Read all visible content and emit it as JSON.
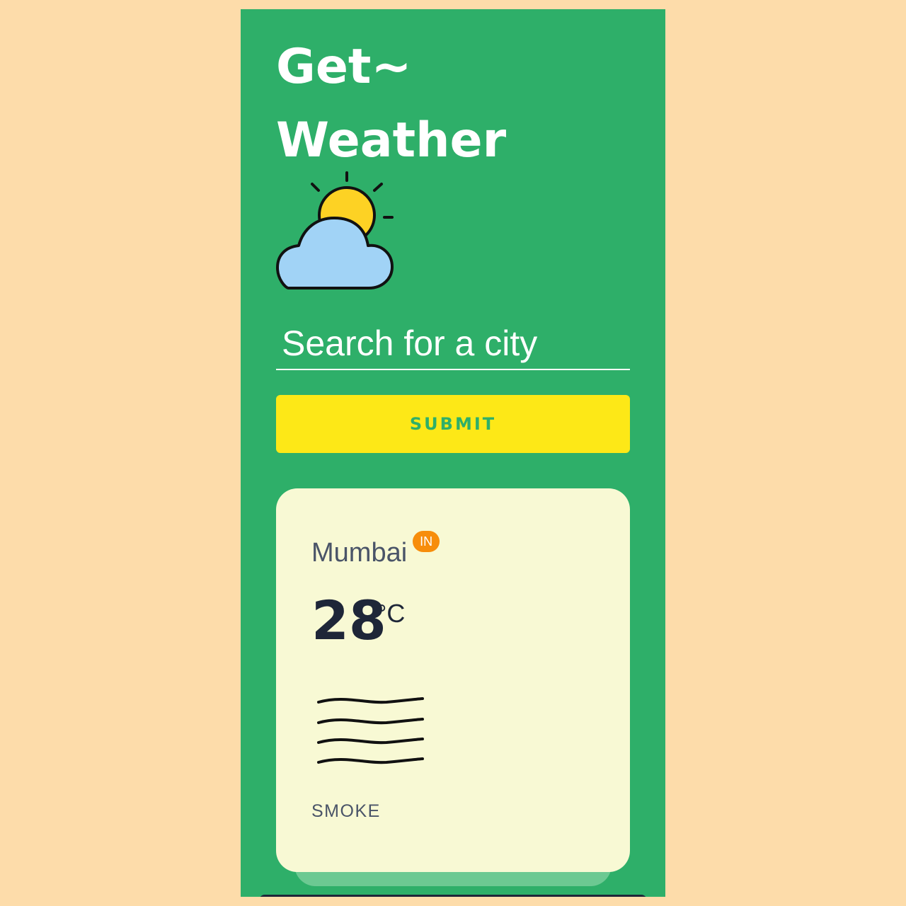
{
  "app": {
    "title_line1": "Get~",
    "title_line2": "Weather",
    "logo_icon": "sun-behind-cloud-icon"
  },
  "search": {
    "placeholder": "Search for a city",
    "value": ""
  },
  "submit": {
    "label": "SUBMIT"
  },
  "result": {
    "city": "Mumbai",
    "country": "IN",
    "temperature": "28",
    "unit": "°C",
    "condition_icon": "mist-lines-icon",
    "description": "SMOKE"
  },
  "colors": {
    "page_background": "#fddcaa",
    "app_background": "#2eaf69",
    "button": "#fde817",
    "card": "#f8f9d4",
    "country_badge": "#f78d0b",
    "text_dark": "#1e2638",
    "text_muted": "#4a5468"
  }
}
